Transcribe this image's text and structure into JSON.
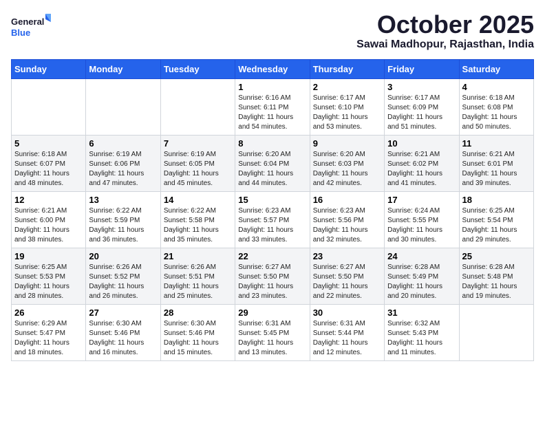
{
  "logo": {
    "line1": "General",
    "line2": "Blue"
  },
  "title": "October 2025",
  "location": "Sawai Madhopur, Rajasthan, India",
  "days_of_week": [
    "Sunday",
    "Monday",
    "Tuesday",
    "Wednesday",
    "Thursday",
    "Friday",
    "Saturday"
  ],
  "weeks": [
    [
      {
        "day": "",
        "info": ""
      },
      {
        "day": "",
        "info": ""
      },
      {
        "day": "",
        "info": ""
      },
      {
        "day": "1",
        "info": "Sunrise: 6:16 AM\nSunset: 6:11 PM\nDaylight: 11 hours\nand 54 minutes."
      },
      {
        "day": "2",
        "info": "Sunrise: 6:17 AM\nSunset: 6:10 PM\nDaylight: 11 hours\nand 53 minutes."
      },
      {
        "day": "3",
        "info": "Sunrise: 6:17 AM\nSunset: 6:09 PM\nDaylight: 11 hours\nand 51 minutes."
      },
      {
        "day": "4",
        "info": "Sunrise: 6:18 AM\nSunset: 6:08 PM\nDaylight: 11 hours\nand 50 minutes."
      }
    ],
    [
      {
        "day": "5",
        "info": "Sunrise: 6:18 AM\nSunset: 6:07 PM\nDaylight: 11 hours\nand 48 minutes."
      },
      {
        "day": "6",
        "info": "Sunrise: 6:19 AM\nSunset: 6:06 PM\nDaylight: 11 hours\nand 47 minutes."
      },
      {
        "day": "7",
        "info": "Sunrise: 6:19 AM\nSunset: 6:05 PM\nDaylight: 11 hours\nand 45 minutes."
      },
      {
        "day": "8",
        "info": "Sunrise: 6:20 AM\nSunset: 6:04 PM\nDaylight: 11 hours\nand 44 minutes."
      },
      {
        "day": "9",
        "info": "Sunrise: 6:20 AM\nSunset: 6:03 PM\nDaylight: 11 hours\nand 42 minutes."
      },
      {
        "day": "10",
        "info": "Sunrise: 6:21 AM\nSunset: 6:02 PM\nDaylight: 11 hours\nand 41 minutes."
      },
      {
        "day": "11",
        "info": "Sunrise: 6:21 AM\nSunset: 6:01 PM\nDaylight: 11 hours\nand 39 minutes."
      }
    ],
    [
      {
        "day": "12",
        "info": "Sunrise: 6:21 AM\nSunset: 6:00 PM\nDaylight: 11 hours\nand 38 minutes."
      },
      {
        "day": "13",
        "info": "Sunrise: 6:22 AM\nSunset: 5:59 PM\nDaylight: 11 hours\nand 36 minutes."
      },
      {
        "day": "14",
        "info": "Sunrise: 6:22 AM\nSunset: 5:58 PM\nDaylight: 11 hours\nand 35 minutes."
      },
      {
        "day": "15",
        "info": "Sunrise: 6:23 AM\nSunset: 5:57 PM\nDaylight: 11 hours\nand 33 minutes."
      },
      {
        "day": "16",
        "info": "Sunrise: 6:23 AM\nSunset: 5:56 PM\nDaylight: 11 hours\nand 32 minutes."
      },
      {
        "day": "17",
        "info": "Sunrise: 6:24 AM\nSunset: 5:55 PM\nDaylight: 11 hours\nand 30 minutes."
      },
      {
        "day": "18",
        "info": "Sunrise: 6:25 AM\nSunset: 5:54 PM\nDaylight: 11 hours\nand 29 minutes."
      }
    ],
    [
      {
        "day": "19",
        "info": "Sunrise: 6:25 AM\nSunset: 5:53 PM\nDaylight: 11 hours\nand 28 minutes."
      },
      {
        "day": "20",
        "info": "Sunrise: 6:26 AM\nSunset: 5:52 PM\nDaylight: 11 hours\nand 26 minutes."
      },
      {
        "day": "21",
        "info": "Sunrise: 6:26 AM\nSunset: 5:51 PM\nDaylight: 11 hours\nand 25 minutes."
      },
      {
        "day": "22",
        "info": "Sunrise: 6:27 AM\nSunset: 5:50 PM\nDaylight: 11 hours\nand 23 minutes."
      },
      {
        "day": "23",
        "info": "Sunrise: 6:27 AM\nSunset: 5:50 PM\nDaylight: 11 hours\nand 22 minutes."
      },
      {
        "day": "24",
        "info": "Sunrise: 6:28 AM\nSunset: 5:49 PM\nDaylight: 11 hours\nand 20 minutes."
      },
      {
        "day": "25",
        "info": "Sunrise: 6:28 AM\nSunset: 5:48 PM\nDaylight: 11 hours\nand 19 minutes."
      }
    ],
    [
      {
        "day": "26",
        "info": "Sunrise: 6:29 AM\nSunset: 5:47 PM\nDaylight: 11 hours\nand 18 minutes."
      },
      {
        "day": "27",
        "info": "Sunrise: 6:30 AM\nSunset: 5:46 PM\nDaylight: 11 hours\nand 16 minutes."
      },
      {
        "day": "28",
        "info": "Sunrise: 6:30 AM\nSunset: 5:46 PM\nDaylight: 11 hours\nand 15 minutes."
      },
      {
        "day": "29",
        "info": "Sunrise: 6:31 AM\nSunset: 5:45 PM\nDaylight: 11 hours\nand 13 minutes."
      },
      {
        "day": "30",
        "info": "Sunrise: 6:31 AM\nSunset: 5:44 PM\nDaylight: 11 hours\nand 12 minutes."
      },
      {
        "day": "31",
        "info": "Sunrise: 6:32 AM\nSunset: 5:43 PM\nDaylight: 11 hours\nand 11 minutes."
      },
      {
        "day": "",
        "info": ""
      }
    ]
  ]
}
